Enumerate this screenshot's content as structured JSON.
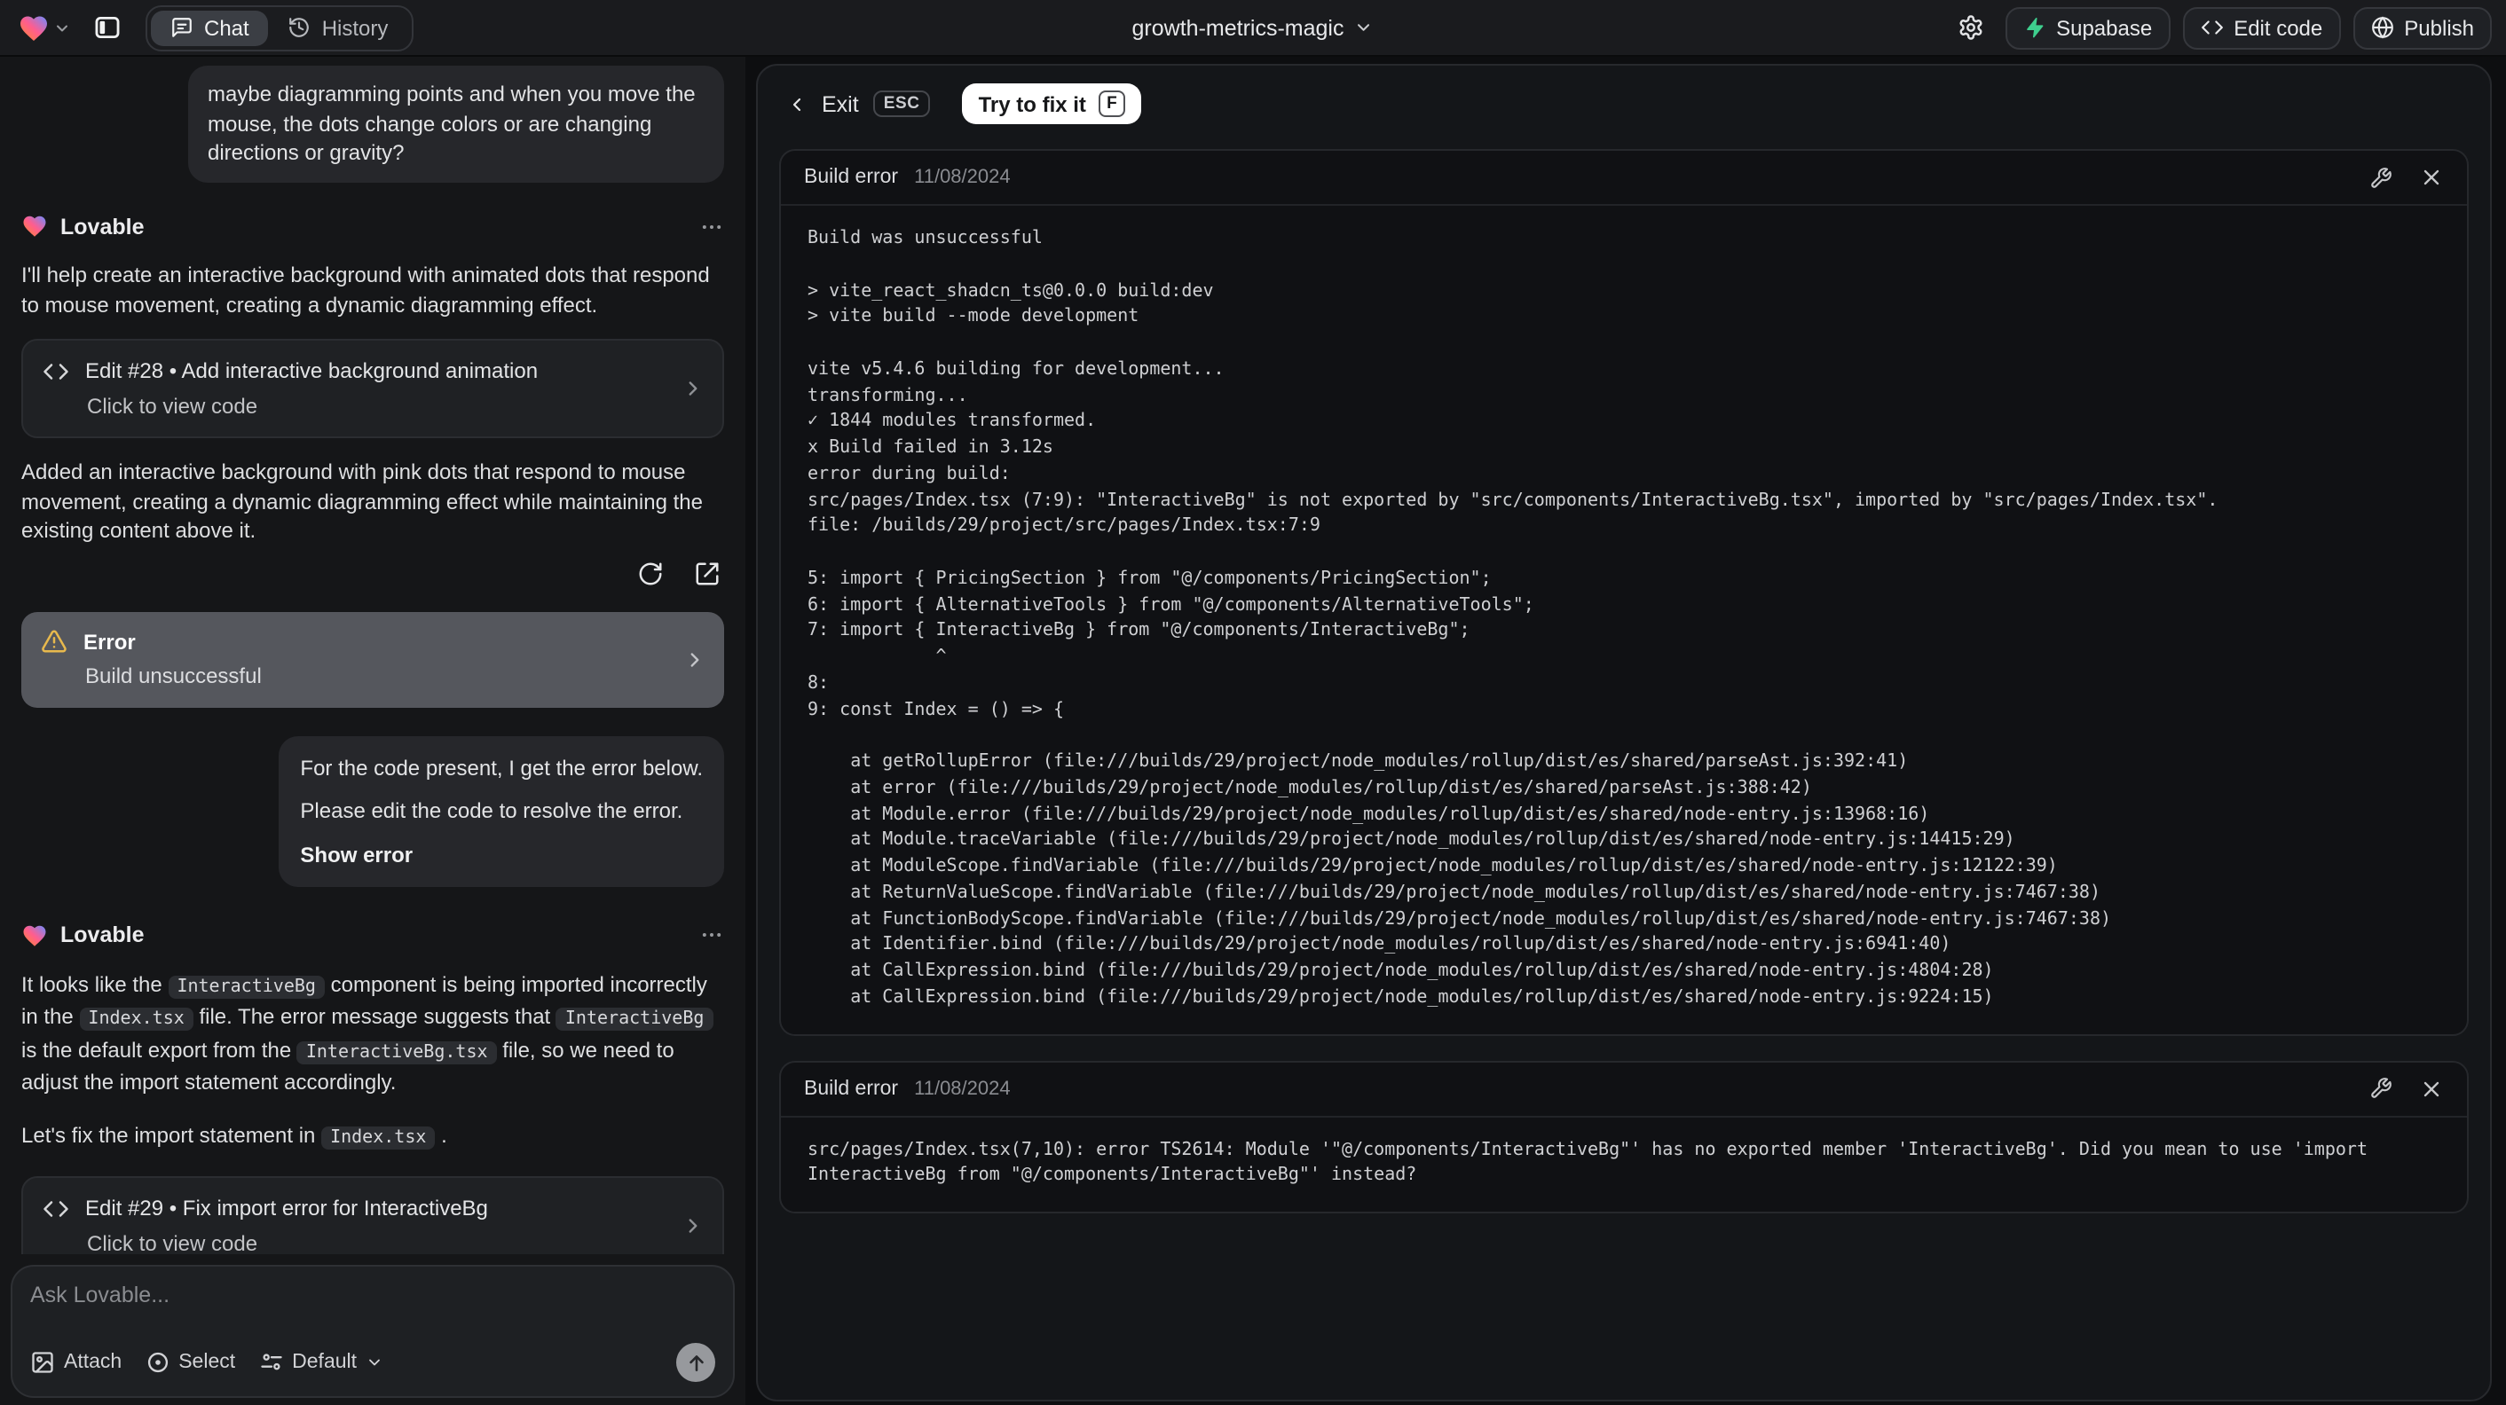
{
  "topbar": {
    "project_name": "growth-metrics-magic",
    "tab_chat": "Chat",
    "tab_history": "History",
    "btn_supabase": "Supabase",
    "btn_edit_code": "Edit code",
    "btn_publish": "Publish"
  },
  "colors": {
    "supabase_green": "#3ecf8e",
    "warning_yellow": "#e8b94d"
  },
  "chat": {
    "assistant_name": "Lovable",
    "user_message_1": "maybe diagramming points and when you move the mouse, the dots change colors or are changing directions or gravity?",
    "assistant_intro": "I'll help create an interactive background with animated dots that respond to mouse movement, creating a dynamic diagramming effect.",
    "edit_card_1": {
      "title": "Edit #28 • Add interactive background animation",
      "subtitle": "Click to view code"
    },
    "assistant_summary": "Added an interactive background with pink dots that respond to mouse movement, creating a dynamic diagramming effect while maintaining the existing content above it.",
    "error_card": {
      "title": "Error",
      "subtitle": "Build unsuccessful"
    },
    "user_message_2": {
      "line1": "For the code present, I get the error below.",
      "line2": "Please edit the code to resolve the error.",
      "action": "Show error"
    },
    "assistant_fix": {
      "seg1": "It looks like the ",
      "code1": "InteractiveBg",
      "seg2": " component is being imported incorrectly in the ",
      "code2": "Index.tsx",
      "seg3": " file. The error message suggests that ",
      "code3": "InteractiveBg",
      "seg4": " is the default export from the ",
      "code4": "InteractiveBg.tsx",
      "seg5": " file, so we need to adjust the import statement accordingly.",
      "line2_prefix": "Let's fix the import statement in ",
      "line2_code": "Index.tsx",
      "line2_suffix": " ."
    },
    "edit_card_2": {
      "title": "Edit #29 • Fix import error for InteractiveBg",
      "subtitle": "Click to view code"
    },
    "composer": {
      "placeholder": "Ask Lovable...",
      "attach": "Attach",
      "select": "Select",
      "model": "Default"
    }
  },
  "panel": {
    "exit": "Exit",
    "esc_key": "ESC",
    "fix_button": "Try to fix it",
    "fix_key": "F",
    "error1": {
      "title": "Build error",
      "date": "11/08/2024",
      "log": "Build was unsuccessful\n\n> vite_react_shadcn_ts@0.0.0 build:dev\n> vite build --mode development\n\nvite v5.4.6 building for development...\ntransforming...\n✓ 1844 modules transformed.\nx Build failed in 3.12s\nerror during build:\nsrc/pages/Index.tsx (7:9): \"InteractiveBg\" is not exported by \"src/components/InteractiveBg.tsx\", imported by \"src/pages/Index.tsx\".\nfile: /builds/29/project/src/pages/Index.tsx:7:9\n\n5: import { PricingSection } from \"@/components/PricingSection\";\n6: import { AlternativeTools } from \"@/components/AlternativeTools\";\n7: import { InteractiveBg } from \"@/components/InteractiveBg\";\n            ^\n8: \n9: const Index = () => {\n\n    at getRollupError (file:///builds/29/project/node_modules/rollup/dist/es/shared/parseAst.js:392:41)\n    at error (file:///builds/29/project/node_modules/rollup/dist/es/shared/parseAst.js:388:42)\n    at Module.error (file:///builds/29/project/node_modules/rollup/dist/es/shared/node-entry.js:13968:16)\n    at Module.traceVariable (file:///builds/29/project/node_modules/rollup/dist/es/shared/node-entry.js:14415:29)\n    at ModuleScope.findVariable (file:///builds/29/project/node_modules/rollup/dist/es/shared/node-entry.js:12122:39)\n    at ReturnValueScope.findVariable (file:///builds/29/project/node_modules/rollup/dist/es/shared/node-entry.js:7467:38)\n    at FunctionBodyScope.findVariable (file:///builds/29/project/node_modules/rollup/dist/es/shared/node-entry.js:7467:38)\n    at Identifier.bind (file:///builds/29/project/node_modules/rollup/dist/es/shared/node-entry.js:6941:40)\n    at CallExpression.bind (file:///builds/29/project/node_modules/rollup/dist/es/shared/node-entry.js:4804:28)\n    at CallExpression.bind (file:///builds/29/project/node_modules/rollup/dist/es/shared/node-entry.js:9224:15)"
    },
    "error2": {
      "title": "Build error",
      "date": "11/08/2024",
      "log": "src/pages/Index.tsx(7,10): error TS2614: Module '\"@/components/InteractiveBg\"' has no exported member 'InteractiveBg'. Did you mean to use 'import InteractiveBg from \"@/components/InteractiveBg\"' instead?"
    }
  }
}
